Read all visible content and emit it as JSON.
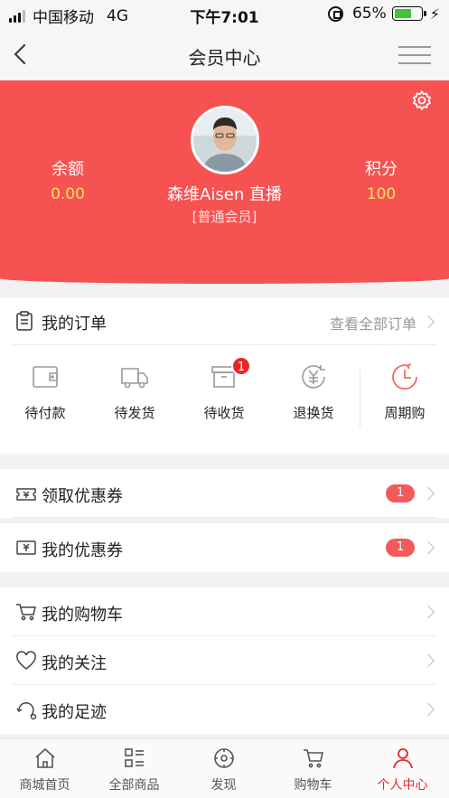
{
  "status_bar": {
    "carrier": "中国移动",
    "network": "4G",
    "time": "下午7:01",
    "battery": "65%"
  },
  "nav": {
    "title": "会员中心"
  },
  "profile": {
    "user_name": "森维Aisen 直播",
    "member_level": "[普通会员]",
    "balance": {
      "label": "余额",
      "value": "0.00"
    },
    "points": {
      "label": "积分",
      "value": "100"
    }
  },
  "orders": {
    "title": "我的订单",
    "view_all": "查看全部订单",
    "items": [
      {
        "label": "待付款",
        "icon": "wallet-icon"
      },
      {
        "label": "待发货",
        "icon": "truck-icon"
      },
      {
        "label": "待收货",
        "icon": "box-icon",
        "badge": "1"
      },
      {
        "label": "退换货",
        "icon": "yen-icon"
      },
      {
        "label": "周期购",
        "icon": "clock-icon"
      }
    ]
  },
  "coupons": [
    {
      "label": "领取优惠券",
      "count": "1",
      "icon": "coupon-get-icon"
    },
    {
      "label": "我的优惠券",
      "count": "1",
      "icon": "coupon-icon"
    }
  ],
  "links": [
    {
      "label": "我的购物车",
      "icon": "cart-icon"
    },
    {
      "label": "我的关注",
      "icon": "heart-icon"
    },
    {
      "label": "我的足迹",
      "icon": "footprint-icon"
    }
  ],
  "tabs": [
    {
      "label": "商城首页",
      "icon": "home-icon"
    },
    {
      "label": "全部商品",
      "icon": "grid-list-icon"
    },
    {
      "label": "发现",
      "icon": "compass-icon"
    },
    {
      "label": "购物车",
      "icon": "cart-icon"
    },
    {
      "label": "个人中心",
      "icon": "person-icon",
      "active": true
    }
  ],
  "colors": {
    "brand_red": "#f65252",
    "accent_yellow": "#ffe066",
    "badge_red": "#e8272a"
  }
}
